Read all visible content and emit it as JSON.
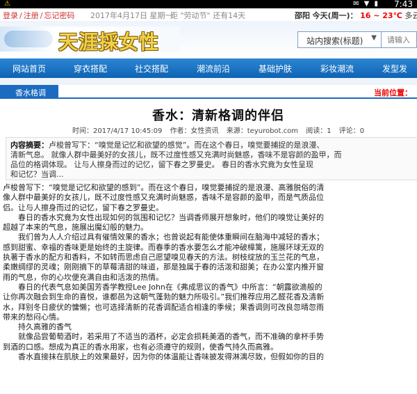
{
  "status_bar": {
    "time": "7:43",
    "icons": "✉ ▼ ▮"
  },
  "top_row": {
    "login": "登录",
    "register": "注册",
    "forgot": "忘记密码",
    "date": "2017年4月17日 星期一",
    "countdown": "距 \"劳动节\" 还有14天",
    "city": "邵阳",
    "today": "今天(周一)：",
    "temp": "16 ~ 23℃",
    "weather_tail": "多云"
  },
  "header": {
    "logo_text": "天涯採女性",
    "search_select": "站内搜索(标题)",
    "search_placeholder": "请输入"
  },
  "nav": {
    "items": [
      "网站首页",
      "穿衣搭配",
      "社交搭配",
      "潮流前沿",
      "基础护肤",
      "彩妆潮流",
      "发型发"
    ]
  },
  "channel": {
    "tab": "香水格调",
    "position": "当前位置："
  },
  "article": {
    "title": "香水：清新格调的伴侣",
    "meta_time": "时间：2017/4/17 10:45:09",
    "meta_author": "作者：女性资讯",
    "meta_source": "来源：teyurobot.com",
    "meta_reads": "阅读：1",
    "meta_comments": "评论：0",
    "summary_label": "内容摘要：",
    "summary_lines": [
      "卢梭曾写下：“嗅觉是记忆和欲望的感觉”。而在这个春日，嗅觉要捕捉的是浪漫、",
      "清新气息。 就像人群中最美好的女孩儿，既不过度性感又充满时尚魅惑，香味不是容颜的盈甲，而",
      "品位的格调体现。 让与人擦身而过的记忆，留下春之罗曼史。         春日的香水究竟为女性呈现",
      "和记忆？当调..."
    ],
    "body_lines": [
      "卢梭曾写下：“嗅觉是记忆和欲望的感到”。而在这个春日，嗅觉要捕捉的是浪漫、高雅脱俗的清",
      "像人群中最美好的女孩儿，既不过度性感又充满时尚魅惑，香味不是容颜的盈甲，而是气质品位",
      "侣。让与人擦身而过的记忆，留下春之罗曼史。",
      "春日的香水究竟为女性出现如何的氛围和记忆？当调香师展开想象时，他们的嗅觉让美好的",
      "超越了本来的气息，施展出魔幻般的魅力。",
      "我们曾为人人介绍过具有催情效果的香水；也曾说起有能使体重瞬间在脑海中减轻的香水；",
      "感到甜蜜、幸福的香味更是始终的主旋律。而春季的香水要怎么才能冲破樟篱，施展环球无双的",
      "执著于香水的配方和香料，不如转而思虑自己愿望嗅见春天的方法。树枝绽放的玉兰花的气息，",
      "柔嫩绸缪的灵魂；刚刚摘下的草莓清甜的味道，那是独属于春的活泼和甜美；在办公室内推开窗",
      "雨的气息，你的心坎便充满自由和活泼的热情。",
      "春日的代表气息如美国芳香学教授Lee   John在《弗成思议的香气》中所言：“朝露欲滴般的",
      "让你再次融会到生命的喜悦，谁都邑为这朝气蓬勃的魅力所吸引。”我们推荐应用乙醛花香及清新",
      "水，拜别冬日疲伏的慵懒；也可选择清新的花香调配适合相逢的季候；果香调则可改良忽晴忽雨",
      "带来的愁闷心情。",
      "持久高雅的香气",
      "就像品尝葡萄酒时，若采用了不适当的酒杯，必定会损耗美酒的香气，而不准确的拿杯手势",
      "到酒的口感。想成为真正的香水用家，也有必须遵守的规则，使香气持久而高雅。",
      "香水直接抹在肌肤上的效果最好，因为你的体温能让香味披发得淋漓尽致，但假如你的目的"
    ]
  }
}
